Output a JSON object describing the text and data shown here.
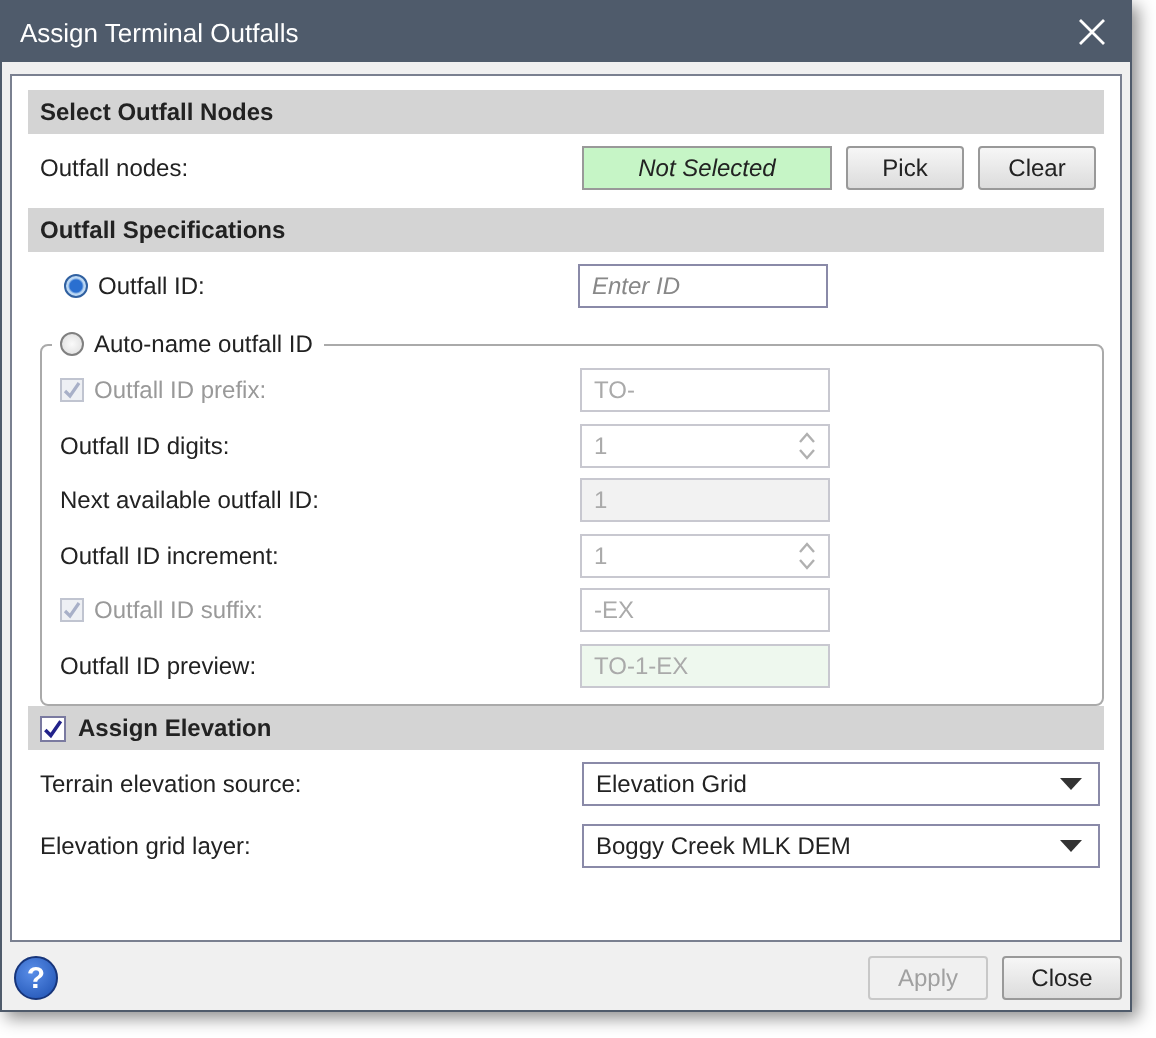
{
  "window": {
    "title": "Assign Terminal Outfalls"
  },
  "select_nodes": {
    "title": "Select Outfall Nodes",
    "label": "Outfall nodes:",
    "status": "Not Selected",
    "buttons": [
      {
        "label": "Pick",
        "disabled": false
      },
      {
        "label": "Clear",
        "disabled": false
      }
    ]
  },
  "specifications": {
    "title": "Outfall Specifications",
    "outfall_id": {
      "label": "Outfall ID:",
      "selected": true,
      "placeholder": "Enter ID"
    },
    "auto_name": {
      "label": "Auto-name outfall ID",
      "selected": false,
      "rows": [
        {
          "kind": "checkbox",
          "label": "Outfall ID prefix:",
          "checked": true,
          "value": "TO-"
        },
        {
          "kind": "spinner",
          "label": "Outfall ID digits:",
          "value": "1"
        },
        {
          "kind": "readonly",
          "label": "Next available outfall ID:",
          "value": "1"
        },
        {
          "kind": "spinner",
          "label": "Outfall ID increment:",
          "value": "1"
        },
        {
          "kind": "checkbox",
          "label": "Outfall ID suffix:",
          "checked": true,
          "value": "-EX"
        },
        {
          "kind": "preview",
          "label": "Outfall ID preview:",
          "value": "TO-1-EX"
        }
      ]
    }
  },
  "elevation": {
    "title": "Assign Elevation",
    "checked": true,
    "rows": [
      {
        "label": "Terrain elevation source:",
        "value": "Elevation Grid"
      },
      {
        "label": "Elevation grid layer:",
        "value": "Boggy Creek MLK DEM"
      }
    ]
  },
  "footer": {
    "help": "?",
    "buttons": [
      {
        "label": "Apply",
        "disabled": true
      },
      {
        "label": "Close",
        "disabled": false
      }
    ]
  }
}
